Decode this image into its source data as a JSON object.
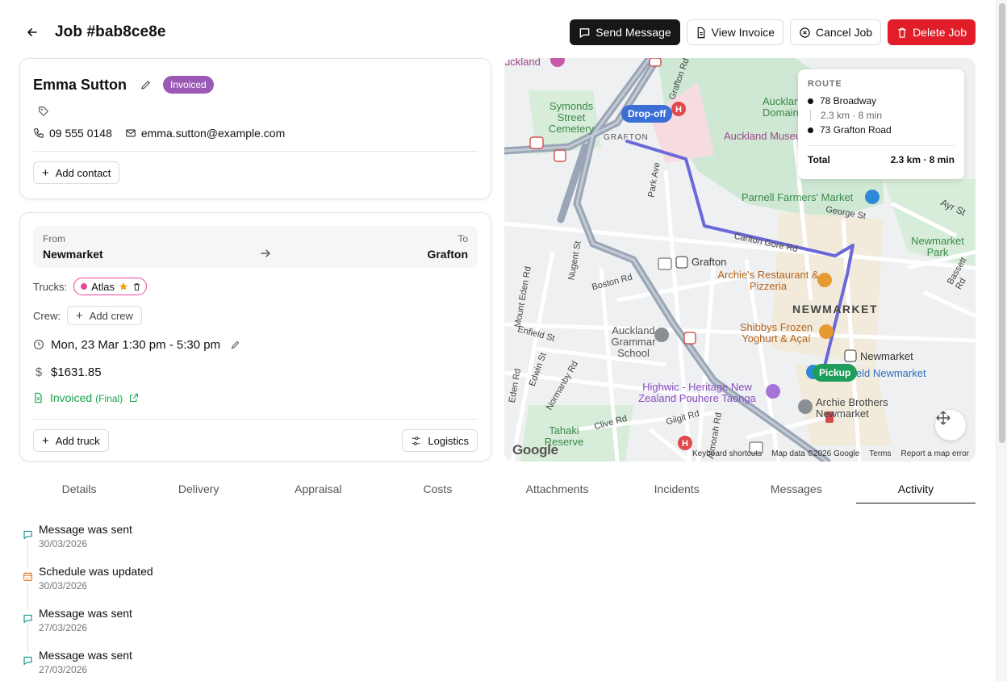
{
  "header": {
    "title": "Job #bab8ce8e",
    "actions": {
      "send_message": "Send Message",
      "view_invoice": "View Invoice",
      "cancel_job": "Cancel Job",
      "delete_job": "Delete Job"
    }
  },
  "customer": {
    "name": "Emma Sutton",
    "status": "Invoiced",
    "phone": "09 555 0148",
    "email": "emma.sutton@example.com",
    "add_contact": "Add contact"
  },
  "job": {
    "from_label": "From",
    "from": "Newmarket",
    "to_label": "To",
    "to": "Grafton",
    "trucks_label": "Trucks:",
    "truck_name": "Atlas",
    "crew_label": "Crew:",
    "add_crew": "Add crew",
    "schedule": "Mon, 23 Mar 1:30 pm - 5:30 pm",
    "price": "$1631.85",
    "invoice_status": "Invoiced",
    "invoice_type": "(Final)",
    "add_truck": "Add truck",
    "logistics": "Logistics"
  },
  "map": {
    "route_heading": "ROUTE",
    "stop1": "78 Broadway",
    "leg": "2.3 km · 8 min",
    "stop2": "73 Grafton Road",
    "total_label": "Total",
    "total_value": "2.3 km · 8 min",
    "dropoff": "Drop-off",
    "pickup": "Pickup",
    "labels": {
      "symonds": "Symonds Street Cemetery",
      "auckland_domain": "Auckland Domain",
      "auckland_museum": "Auckland Museum",
      "parnell": "Parnell Farmers' Market",
      "grafton": "Grafton",
      "archies": "Archie's Restaurant & Pizzeria",
      "newmarket": "NEWMARKET",
      "newmarket_park": "Newmarket Park",
      "shibbys": "Shibbys Frozen Yoghurt & Açaí",
      "grammar": "Auckland Grammar School",
      "newmarket_station": "Newmarket",
      "highwic": "Highwic - Heritage New Zealand Pouhere Taonga",
      "archie_brothers": "Archie Brothers Newmarket",
      "tahaki": "Tahaki Reserve",
      "carlton_gore": "Carlton Gore Rd",
      "george": "George St",
      "ayr": "Ayr St",
      "boston": "Boston Rd",
      "park_ave": "Park Ave",
      "grafton_rd": "Grafton Rd",
      "nugent": "Nugent St",
      "enfield": "Enfield St",
      "edwin": "Edwin St",
      "normanby": "Normanby Rd",
      "clive": "Clive Rd",
      "gilgit": "Gilgit Rd",
      "almorah": "Almorah Rd",
      "mt_eden": "Mount Eden Rd",
      "eden": "Eden Rd",
      "grafton_caps": "GRAFTON",
      "field_newmarket": "ield Newmarket",
      "auckland_top": "uckland",
      "bassett": "Bassett Rd"
    },
    "footer": {
      "shortcuts": "Keyboard shortcuts",
      "data": "Map data ©2026 Google",
      "terms": "Terms",
      "report": "Report a map error"
    },
    "brand": "Google"
  },
  "tabs": [
    "Details",
    "Delivery",
    "Appraisal",
    "Costs",
    "Attachments",
    "Incidents",
    "Messages",
    "Activity"
  ],
  "activity": [
    {
      "title": "Message was sent",
      "date": "30/03/2026"
    },
    {
      "title": "Schedule was updated",
      "date": "30/03/2026"
    },
    {
      "title": "Message was sent",
      "date": "27/03/2026"
    },
    {
      "title": "Message was sent",
      "date": "27/03/2026"
    }
  ],
  "colors": {
    "accent_red": "#e11d2a",
    "badge_purple": "#9b59b6",
    "route_line": "#6b68d8",
    "dropoff_blue": "#3b6fd6",
    "pickup_green": "#1e9e5a",
    "invoiced_green": "#16a34a",
    "truck_pink": "#ec4899"
  }
}
